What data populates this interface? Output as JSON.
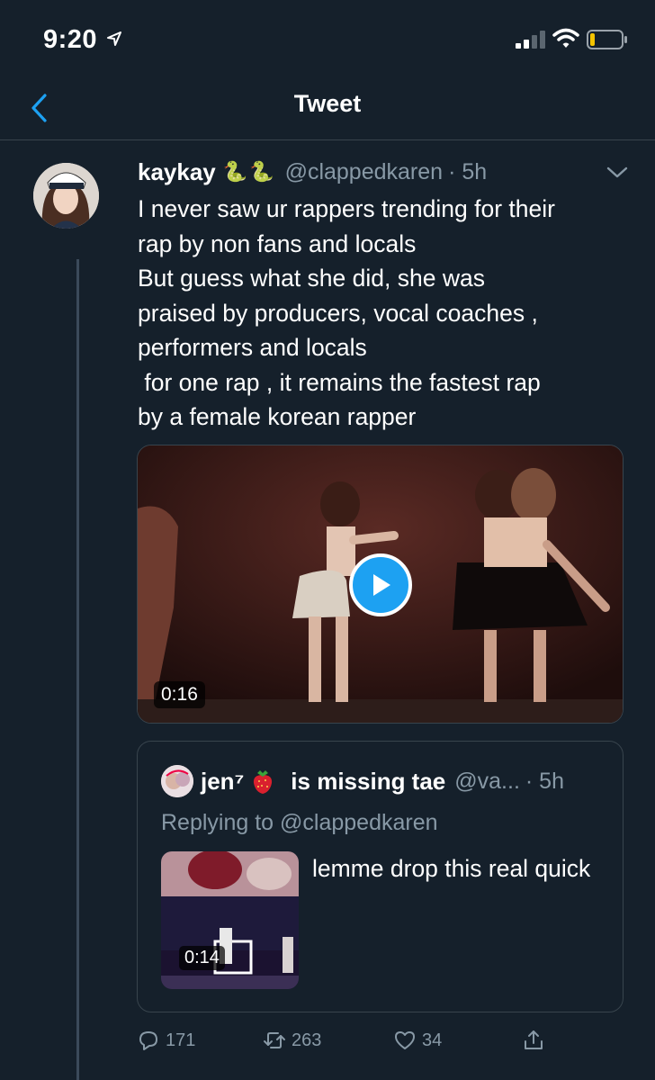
{
  "status_bar": {
    "time": "9:20"
  },
  "nav": {
    "title": "Tweet"
  },
  "tweet": {
    "display_name": "kaykay",
    "name_emoji": "🐍🐍",
    "handle": "@clappedkaren",
    "time": "· 5h",
    "text": "I never saw ur rappers trending for their\nrap by non fans and locals\nBut guess what she did, she was\npraised by producers, vocal coaches ,\nperformers and locals\n for one rap , it remains the fastest rap\nby a female korean rapper",
    "video_duration": "0:16"
  },
  "quote": {
    "display_name": "jen⁷",
    "display_name_rest": "is missing tae",
    "handle": "@va...",
    "time": "· 5h",
    "replying_to": "Replying to @clappedkaren",
    "text": "lemme drop this real quick",
    "video_duration": "0:14"
  },
  "actions": {
    "replies": "171",
    "retweets": "263",
    "likes": "34"
  },
  "colors": {
    "background": "#15202b",
    "accent": "#1da1f2",
    "secondary_text": "#8899a6",
    "border": "#38444d"
  }
}
